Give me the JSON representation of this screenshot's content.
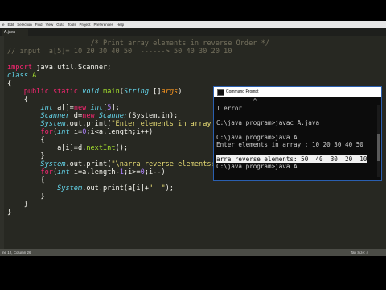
{
  "menubar": {
    "items": [
      "le",
      "Edit",
      "Selection",
      "Find",
      "View",
      "Goto",
      "Tools",
      "Project",
      "Preferences",
      "Help"
    ]
  },
  "tab": {
    "label": "A.java"
  },
  "code": [
    "                    /* Print array elements in reverse Order */",
    "// input  a[5]= 10 20 30 40 50  ------> 50 40 30 20 10",
    "",
    "import java.util.Scanner;",
    "class A",
    "{",
    "    public static void main(String []args)",
    "    {",
    "        int a[]=new int[5];",
    "        Scanner d=new Scanner(System.in);",
    "        System.out.print(\"Enter elements in array : \");",
    "        for(int i=0;i<a.length;i++)",
    "        {",
    "            a[i]=d.nextInt();",
    "        }",
    "        System.out.print(\"\\narra reverse elements: \");",
    "        for(int i=a.length-1;i>=0;i--)",
    "        {",
    "            System.out.print(a[i]+\"  \");",
    "        }",
    "    }",
    "}"
  ],
  "status": {
    "position": "ne 12, Column 26",
    "tab_size": "Tab Size: 4"
  },
  "cmd": {
    "title": "Command Prompt",
    "lines": [
      "          ^",
      "1 error",
      "",
      "C:\\java program>javac A.java",
      "",
      "C:\\java program>java A",
      "Enter elements in array : 10 20 30 40 50",
      "",
      "arra reverse elements: 50  40  30  20  10",
      "C:\\java program>java A"
    ]
  },
  "colors": {
    "editor_bg": "#272822",
    "keyword": "#f92672",
    "string": "#e6db74",
    "comment": "#75715e",
    "type": "#66d9ef"
  }
}
